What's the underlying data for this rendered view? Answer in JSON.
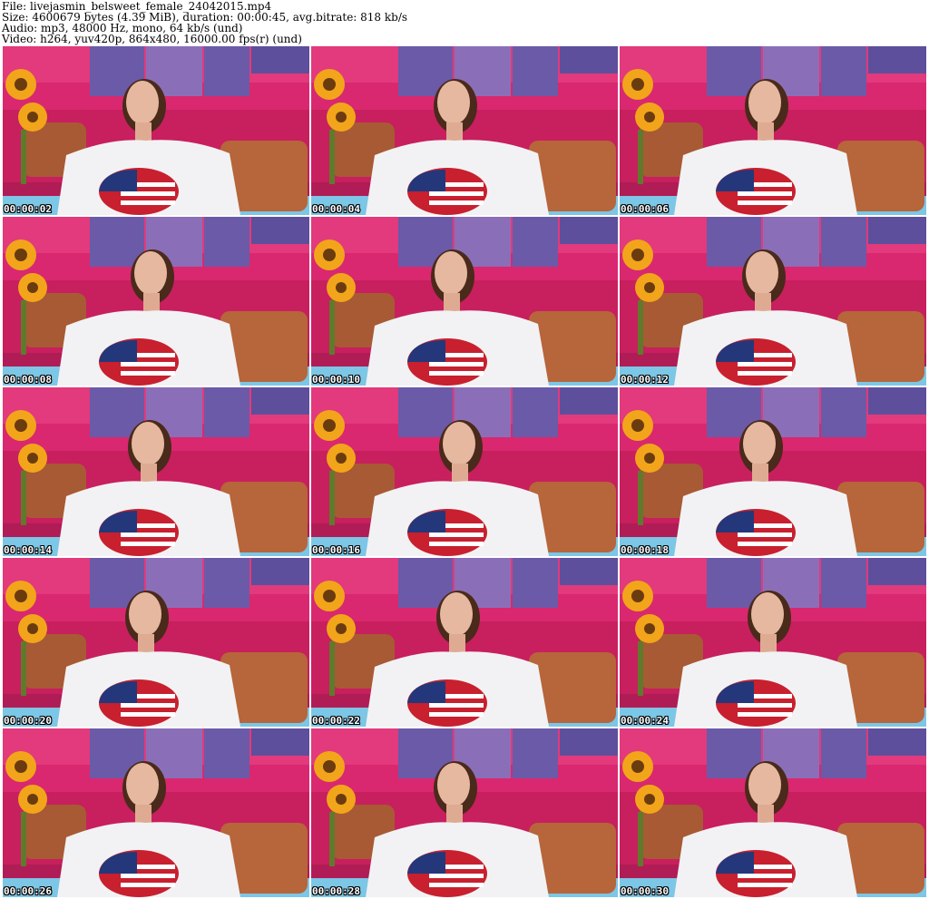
{
  "header": {
    "file_line": "File: livejasmin_belsweet_female_24042015.mp4",
    "size_line": "Size: 4600679 bytes (4.39 MiB), duration: 00:00:45, avg.bitrate: 818 kb/s",
    "audio_line": "Audio: mp3, 48000 Hz, mono, 64 kb/s (und)",
    "video_line": "Video: h264, yuv420p, 864x480, 16000.00 fps(r) (und)"
  },
  "thumbnails": [
    {
      "timestamp": "00:00:02"
    },
    {
      "timestamp": "00:00:04"
    },
    {
      "timestamp": "00:00:06"
    },
    {
      "timestamp": "00:00:08"
    },
    {
      "timestamp": "00:00:10"
    },
    {
      "timestamp": "00:00:12"
    },
    {
      "timestamp": "00:00:14"
    },
    {
      "timestamp": "00:00:16"
    },
    {
      "timestamp": "00:00:18"
    },
    {
      "timestamp": "00:00:20"
    },
    {
      "timestamp": "00:00:22"
    },
    {
      "timestamp": "00:00:24"
    },
    {
      "timestamp": "00:00:26"
    },
    {
      "timestamp": "00:00:28"
    },
    {
      "timestamp": "00:00:30"
    }
  ],
  "colors": {
    "wall": "#d9286f",
    "couch": "#c81f5e",
    "canvas_art": "#6b5aa8",
    "pillow": "#b7653a",
    "shirt": "#f2f2f4",
    "flag_blue": "#24377a",
    "flag_red": "#c8202e",
    "sunflower": "#f2a51a",
    "sheet": "#7cc6e6"
  }
}
